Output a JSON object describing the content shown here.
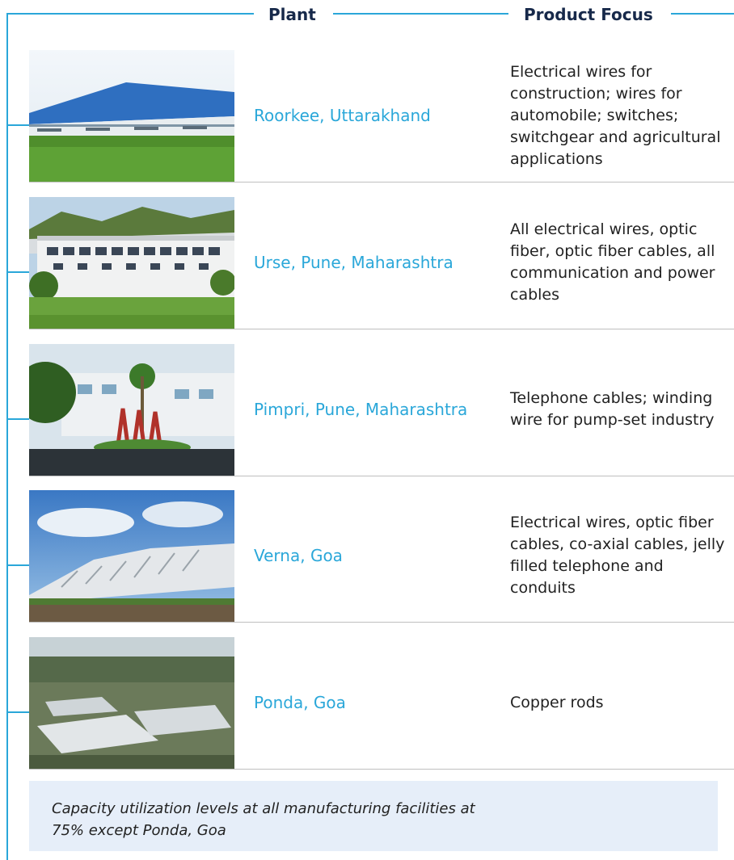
{
  "header": {
    "plant_label": "Plant",
    "focus_label": "Product Focus"
  },
  "colors": {
    "accent": "#2aa7d9",
    "heading": "#17294a",
    "note_bg": "#e6eef9"
  },
  "plants": [
    {
      "name": "Roorkee, Uttarakhand",
      "focus": "Electrical wires for construction; wires for automobile; switches; switchgear and agricultural applications"
    },
    {
      "name": "Urse, Pune, Maharashtra",
      "focus": "All electrical wires, optic fiber, optic fiber cables, all communication and power cables"
    },
    {
      "name": "Pimpri, Pune, Maharashtra",
      "focus": "Telephone cables; winding wire for pump-set industry"
    },
    {
      "name": "Verna, Goa",
      "focus": "Electrical wires, optic fiber cables, co-axial cables, jelly filled telephone and conduits"
    },
    {
      "name": "Ponda, Goa",
      "focus": "Copper rods"
    }
  ],
  "note": {
    "text": "Capacity utilization levels at all manufacturing facilities at 75% except Ponda, Goa"
  }
}
